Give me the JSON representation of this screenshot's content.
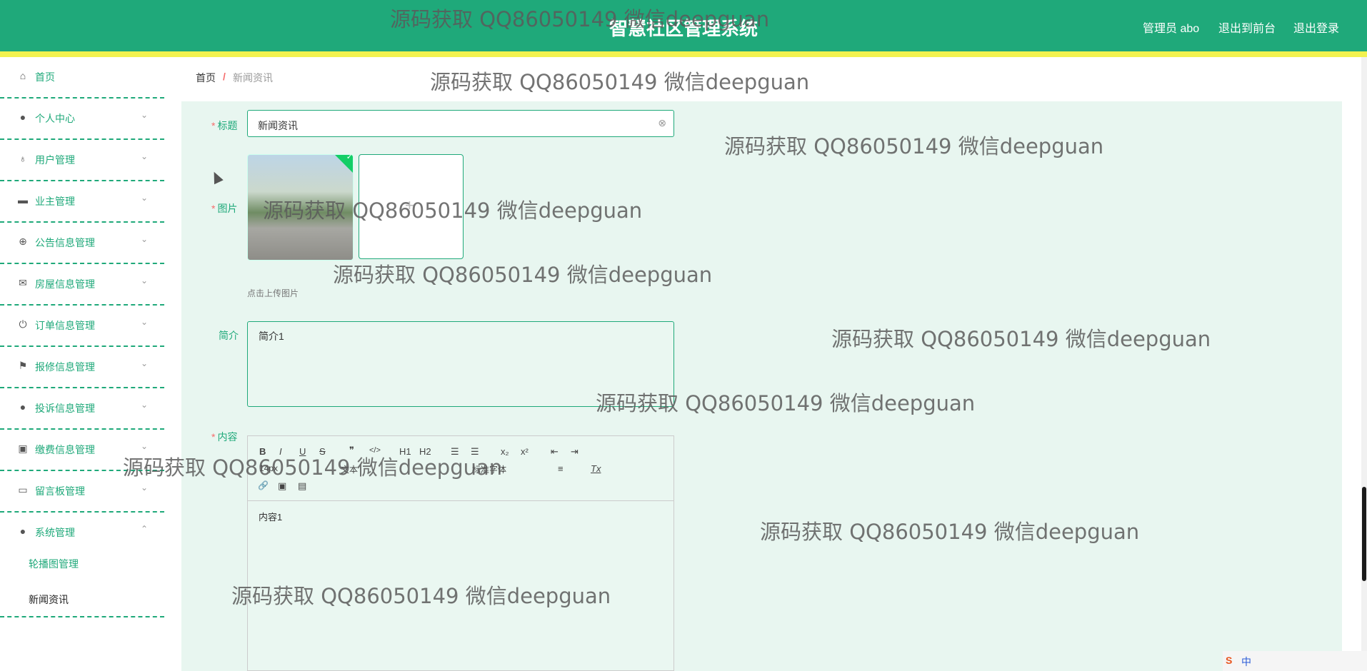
{
  "header": {
    "title": "智慧社区管理系统",
    "admin": "管理员 abo",
    "to_front": "退出到前台",
    "logout": "退出登录"
  },
  "sidebar": {
    "items": [
      {
        "label": "首页",
        "icon": "home-icon"
      },
      {
        "label": "个人中心",
        "icon": "user-icon"
      },
      {
        "label": "用户管理",
        "icon": "mic-icon"
      },
      {
        "label": "业主管理",
        "icon": "stamp-icon"
      },
      {
        "label": "公告信息管理",
        "icon": "compass-icon"
      },
      {
        "label": "房屋信息管理",
        "icon": "mail-icon"
      },
      {
        "label": "订单信息管理",
        "icon": "power-icon"
      },
      {
        "label": "报修信息管理",
        "icon": "flag-icon"
      },
      {
        "label": "投诉信息管理",
        "icon": "bulb-icon"
      },
      {
        "label": "缴费信息管理",
        "icon": "clipboard-icon"
      },
      {
        "label": "留言板管理",
        "icon": "monitor-icon"
      },
      {
        "label": "系统管理",
        "icon": "user-icon"
      }
    ],
    "sub_items": [
      "轮播图管理",
      "新闻资讯"
    ]
  },
  "breadcrumb": {
    "home": "首页",
    "separator": "/",
    "current": "新闻资讯"
  },
  "form": {
    "title_label": "标题",
    "title_value": "新闻资讯",
    "image_label": "图片",
    "upload_tip": "点击上传图片",
    "intro_label": "简介",
    "intro_value": "简介1",
    "content_label": "内容",
    "content_value": "内容1",
    "required_mark": "*"
  },
  "editor_toolbar": {
    "bold": "B",
    "italic": "I",
    "underline": "U",
    "strike": "S",
    "quote": "❞",
    "code": "</>",
    "h1": "H1",
    "h2": "H2",
    "ol": "☰",
    "ul": "☰",
    "sub": "x₂",
    "sup": "x²",
    "outdent": "⇤",
    "indent": "⇥",
    "size": "14px",
    "text": "文本",
    "font": "标准字体",
    "align": "≡",
    "clear": "Tx",
    "link": "🔗",
    "image": "▣",
    "video": "▤"
  },
  "watermark": "源码获取 QQ86050149 微信deepguan",
  "tray": {
    "ime": "S",
    "lang": "中"
  }
}
